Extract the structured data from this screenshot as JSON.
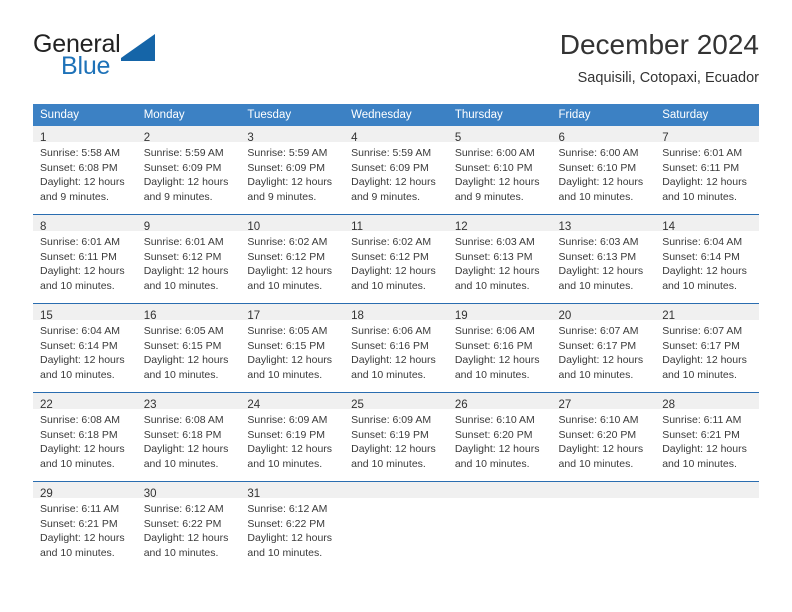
{
  "brand": {
    "name_part1": "General",
    "name_part2": "Blue",
    "accent_color": "#1565a8"
  },
  "header": {
    "title": "December 2024",
    "subtitle": "Saquisili, Cotopaxi, Ecuador"
  },
  "calendar": {
    "header_color": "#3c81c4",
    "weekday_headers": [
      "Sunday",
      "Monday",
      "Tuesday",
      "Wednesday",
      "Thursday",
      "Friday",
      "Saturday"
    ],
    "weeks": [
      [
        {
          "day": "1",
          "sunrise": "Sunrise: 5:58 AM",
          "sunset": "Sunset: 6:08 PM",
          "daylight": "Daylight: 12 hours and 9 minutes."
        },
        {
          "day": "2",
          "sunrise": "Sunrise: 5:59 AM",
          "sunset": "Sunset: 6:09 PM",
          "daylight": "Daylight: 12 hours and 9 minutes."
        },
        {
          "day": "3",
          "sunrise": "Sunrise: 5:59 AM",
          "sunset": "Sunset: 6:09 PM",
          "daylight": "Daylight: 12 hours and 9 minutes."
        },
        {
          "day": "4",
          "sunrise": "Sunrise: 5:59 AM",
          "sunset": "Sunset: 6:09 PM",
          "daylight": "Daylight: 12 hours and 9 minutes."
        },
        {
          "day": "5",
          "sunrise": "Sunrise: 6:00 AM",
          "sunset": "Sunset: 6:10 PM",
          "daylight": "Daylight: 12 hours and 9 minutes."
        },
        {
          "day": "6",
          "sunrise": "Sunrise: 6:00 AM",
          "sunset": "Sunset: 6:10 PM",
          "daylight": "Daylight: 12 hours and 10 minutes."
        },
        {
          "day": "7",
          "sunrise": "Sunrise: 6:01 AM",
          "sunset": "Sunset: 6:11 PM",
          "daylight": "Daylight: 12 hours and 10 minutes."
        }
      ],
      [
        {
          "day": "8",
          "sunrise": "Sunrise: 6:01 AM",
          "sunset": "Sunset: 6:11 PM",
          "daylight": "Daylight: 12 hours and 10 minutes."
        },
        {
          "day": "9",
          "sunrise": "Sunrise: 6:01 AM",
          "sunset": "Sunset: 6:12 PM",
          "daylight": "Daylight: 12 hours and 10 minutes."
        },
        {
          "day": "10",
          "sunrise": "Sunrise: 6:02 AM",
          "sunset": "Sunset: 6:12 PM",
          "daylight": "Daylight: 12 hours and 10 minutes."
        },
        {
          "day": "11",
          "sunrise": "Sunrise: 6:02 AM",
          "sunset": "Sunset: 6:12 PM",
          "daylight": "Daylight: 12 hours and 10 minutes."
        },
        {
          "day": "12",
          "sunrise": "Sunrise: 6:03 AM",
          "sunset": "Sunset: 6:13 PM",
          "daylight": "Daylight: 12 hours and 10 minutes."
        },
        {
          "day": "13",
          "sunrise": "Sunrise: 6:03 AM",
          "sunset": "Sunset: 6:13 PM",
          "daylight": "Daylight: 12 hours and 10 minutes."
        },
        {
          "day": "14",
          "sunrise": "Sunrise: 6:04 AM",
          "sunset": "Sunset: 6:14 PM",
          "daylight": "Daylight: 12 hours and 10 minutes."
        }
      ],
      [
        {
          "day": "15",
          "sunrise": "Sunrise: 6:04 AM",
          "sunset": "Sunset: 6:14 PM",
          "daylight": "Daylight: 12 hours and 10 minutes."
        },
        {
          "day": "16",
          "sunrise": "Sunrise: 6:05 AM",
          "sunset": "Sunset: 6:15 PM",
          "daylight": "Daylight: 12 hours and 10 minutes."
        },
        {
          "day": "17",
          "sunrise": "Sunrise: 6:05 AM",
          "sunset": "Sunset: 6:15 PM",
          "daylight": "Daylight: 12 hours and 10 minutes."
        },
        {
          "day": "18",
          "sunrise": "Sunrise: 6:06 AM",
          "sunset": "Sunset: 6:16 PM",
          "daylight": "Daylight: 12 hours and 10 minutes."
        },
        {
          "day": "19",
          "sunrise": "Sunrise: 6:06 AM",
          "sunset": "Sunset: 6:16 PM",
          "daylight": "Daylight: 12 hours and 10 minutes."
        },
        {
          "day": "20",
          "sunrise": "Sunrise: 6:07 AM",
          "sunset": "Sunset: 6:17 PM",
          "daylight": "Daylight: 12 hours and 10 minutes."
        },
        {
          "day": "21",
          "sunrise": "Sunrise: 6:07 AM",
          "sunset": "Sunset: 6:17 PM",
          "daylight": "Daylight: 12 hours and 10 minutes."
        }
      ],
      [
        {
          "day": "22",
          "sunrise": "Sunrise: 6:08 AM",
          "sunset": "Sunset: 6:18 PM",
          "daylight": "Daylight: 12 hours and 10 minutes."
        },
        {
          "day": "23",
          "sunrise": "Sunrise: 6:08 AM",
          "sunset": "Sunset: 6:18 PM",
          "daylight": "Daylight: 12 hours and 10 minutes."
        },
        {
          "day": "24",
          "sunrise": "Sunrise: 6:09 AM",
          "sunset": "Sunset: 6:19 PM",
          "daylight": "Daylight: 12 hours and 10 minutes."
        },
        {
          "day": "25",
          "sunrise": "Sunrise: 6:09 AM",
          "sunset": "Sunset: 6:19 PM",
          "daylight": "Daylight: 12 hours and 10 minutes."
        },
        {
          "day": "26",
          "sunrise": "Sunrise: 6:10 AM",
          "sunset": "Sunset: 6:20 PM",
          "daylight": "Daylight: 12 hours and 10 minutes."
        },
        {
          "day": "27",
          "sunrise": "Sunrise: 6:10 AM",
          "sunset": "Sunset: 6:20 PM",
          "daylight": "Daylight: 12 hours and 10 minutes."
        },
        {
          "day": "28",
          "sunrise": "Sunrise: 6:11 AM",
          "sunset": "Sunset: 6:21 PM",
          "daylight": "Daylight: 12 hours and 10 minutes."
        }
      ],
      [
        {
          "day": "29",
          "sunrise": "Sunrise: 6:11 AM",
          "sunset": "Sunset: 6:21 PM",
          "daylight": "Daylight: 12 hours and 10 minutes."
        },
        {
          "day": "30",
          "sunrise": "Sunrise: 6:12 AM",
          "sunset": "Sunset: 6:22 PM",
          "daylight": "Daylight: 12 hours and 10 minutes."
        },
        {
          "day": "31",
          "sunrise": "Sunrise: 6:12 AM",
          "sunset": "Sunset: 6:22 PM",
          "daylight": "Daylight: 12 hours and 10 minutes."
        },
        {
          "day": "",
          "sunrise": "",
          "sunset": "",
          "daylight": ""
        },
        {
          "day": "",
          "sunrise": "",
          "sunset": "",
          "daylight": ""
        },
        {
          "day": "",
          "sunrise": "",
          "sunset": "",
          "daylight": ""
        },
        {
          "day": "",
          "sunrise": "",
          "sunset": "",
          "daylight": ""
        }
      ]
    ]
  }
}
